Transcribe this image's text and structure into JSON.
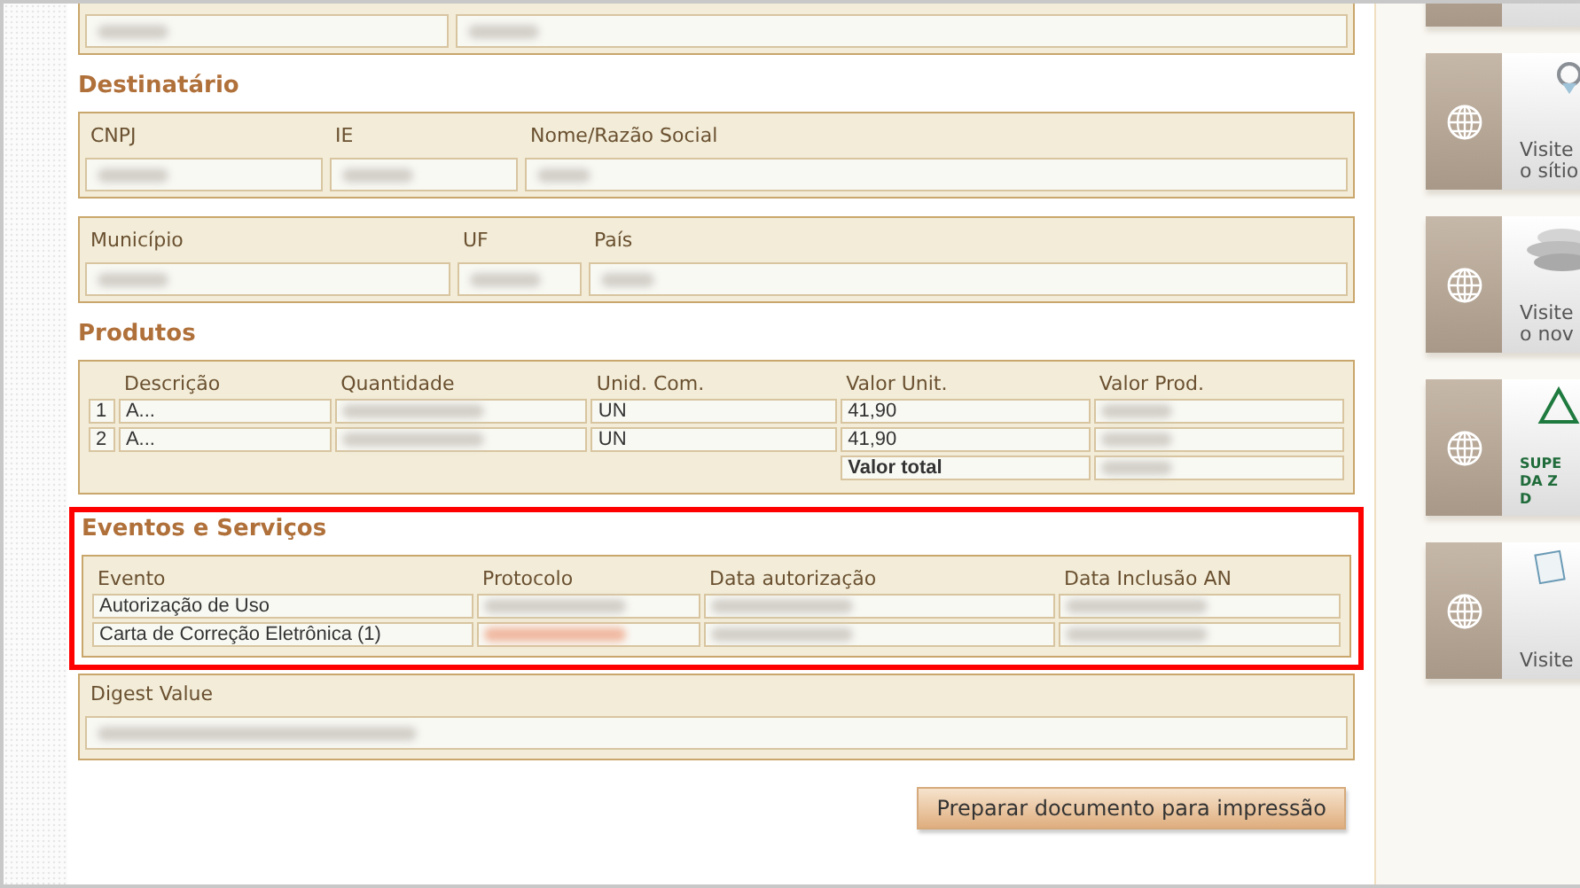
{
  "top_section": {
    "fields": [
      {
        "redacted": true
      },
      {
        "redacted": true
      }
    ]
  },
  "destinatario": {
    "title": "Destinatário",
    "groups": [
      {
        "fields": [
          {
            "label": "CNPJ",
            "redacted": true
          },
          {
            "label": "IE",
            "redacted": true
          },
          {
            "label": "Nome/Razão Social",
            "redacted": true
          }
        ]
      },
      {
        "fields": [
          {
            "label": "Município",
            "redacted": true
          },
          {
            "label": "UF",
            "redacted": true
          },
          {
            "label": "País",
            "redacted": true
          }
        ]
      }
    ]
  },
  "produtos": {
    "title": "Produtos",
    "columns": [
      "Descrição",
      "Quantidade",
      "Unid. Com.",
      "Valor Unit.",
      "Valor Prod."
    ],
    "rows": [
      {
        "index": "1",
        "cells": [
          {
            "text": "A..."
          },
          {
            "redacted": true
          },
          {
            "text": "UN"
          },
          {
            "text": "41,90"
          },
          {
            "redacted": true
          }
        ]
      },
      {
        "index": "2",
        "cells": [
          {
            "text": "A..."
          },
          {
            "redacted": true
          },
          {
            "text": "UN"
          },
          {
            "text": "41,90"
          },
          {
            "redacted": true
          }
        ]
      }
    ],
    "total": {
      "label": "Valor total",
      "redacted": true
    }
  },
  "eventos": {
    "title": "Eventos e Serviços",
    "highlighted": true,
    "columns": [
      "Evento",
      "Protocolo",
      "Data autorização",
      "Data Inclusão AN"
    ],
    "rows": [
      {
        "cells": [
          {
            "text": "Autorização de Uso"
          },
          {
            "redacted": true,
            "alert": false
          },
          {
            "redacted": true
          },
          {
            "redacted": true
          }
        ]
      },
      {
        "cells": [
          {
            "text": "Carta de Correção Eletrônica (1)"
          },
          {
            "redacted": true,
            "alert": true
          },
          {
            "redacted": true
          },
          {
            "redacted": true
          }
        ]
      }
    ]
  },
  "digest": {
    "label": "Digest Value",
    "redacted": true
  },
  "print_button": "Preparar documento para impressão",
  "sidebar": {
    "cards": [
      {
        "kind": "plain"
      },
      {
        "kind": "seal",
        "lines": [
          "Visite",
          "o sítio"
        ]
      },
      {
        "kind": "discs",
        "lines": [
          "Visite",
          "o nov"
        ]
      },
      {
        "kind": "triangle",
        "lines": [
          "SUPE",
          "DA Z",
          "D"
        ]
      },
      {
        "kind": "document",
        "lines": [
          "Visite"
        ]
      }
    ]
  }
}
